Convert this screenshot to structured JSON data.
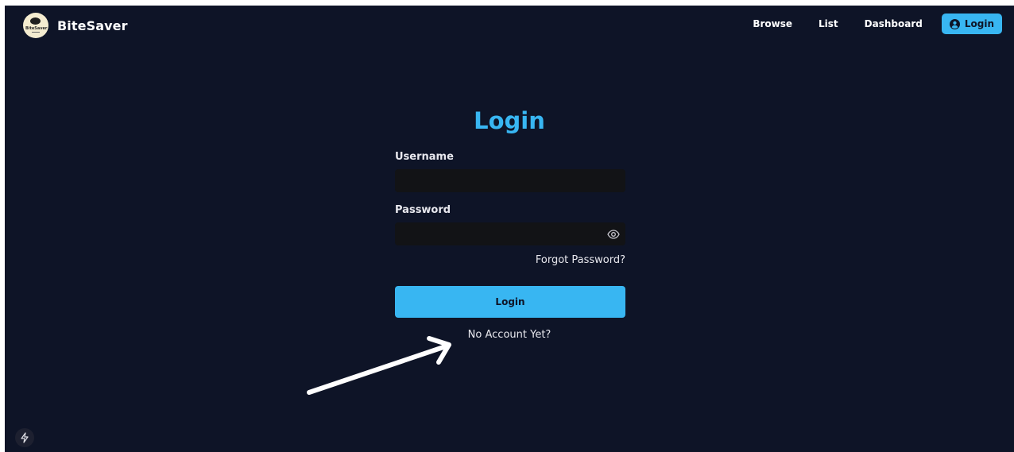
{
  "header": {
    "brand_name": "BiteSaver",
    "logo_text": "BiteSaver",
    "nav": {
      "browse": "Browse",
      "list": "List",
      "dashboard": "Dashboard",
      "login": "Login"
    }
  },
  "form": {
    "title": "Login",
    "username_label": "Username",
    "username_value": "",
    "password_label": "Password",
    "password_value": "",
    "forgot_password": "Forgot Password?",
    "submit_label": "Login",
    "no_account": "No Account Yet?"
  },
  "icons": {
    "user": "user-circle-icon",
    "eye": "eye-icon",
    "arrow": "arrow-annotation-icon",
    "bolt": "lightning-icon"
  },
  "colors": {
    "background": "#0e1427",
    "accent": "#38b6f2",
    "input_bg": "#121316",
    "text": "#e8e8ee"
  }
}
